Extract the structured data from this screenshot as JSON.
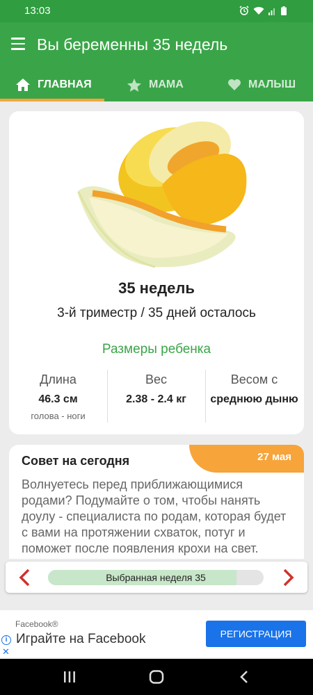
{
  "status": {
    "time": "13:03"
  },
  "appbar": {
    "title": "Вы беременны 35 недель"
  },
  "tabs": [
    {
      "label": "ГЛАВНАЯ",
      "icon": "home-icon"
    },
    {
      "label": "МАМА",
      "icon": "star-icon"
    },
    {
      "label": "МАЛЫШ",
      "icon": "heart-icon"
    }
  ],
  "main": {
    "weeks": "35 недель",
    "trimester": "3-й триместр / 35 дней осталось",
    "sizes_title": "Размеры ребенка",
    "stats": [
      {
        "label": "Длина",
        "value": "46.3 см",
        "sub": "голова - ноги"
      },
      {
        "label": "Вес",
        "value": "2.38 - 2.4 кг"
      },
      {
        "label": "Весом с",
        "value": "среднюю дыню"
      }
    ]
  },
  "tip": {
    "title": "Совет на сегодня",
    "date": "27 мая",
    "text": "Волнуетесь перед приближающимися родами? Подумайте о том, чтобы нанять доулу - специалиста по родам, которая будет с вами на протяжении схваток, потуг и поможет после появления крохи на свет."
  },
  "week_selector": {
    "label": "Выбранная неделя 35",
    "progress": 0.875
  },
  "ad": {
    "brand": "Facebook®",
    "headline": "Играйте на Facebook",
    "cta": "РЕГИСТРАЦИЯ"
  },
  "colors": {
    "primary": "#3aa548",
    "accent": "#f7a43a",
    "ad_blue": "#1a73e8"
  }
}
